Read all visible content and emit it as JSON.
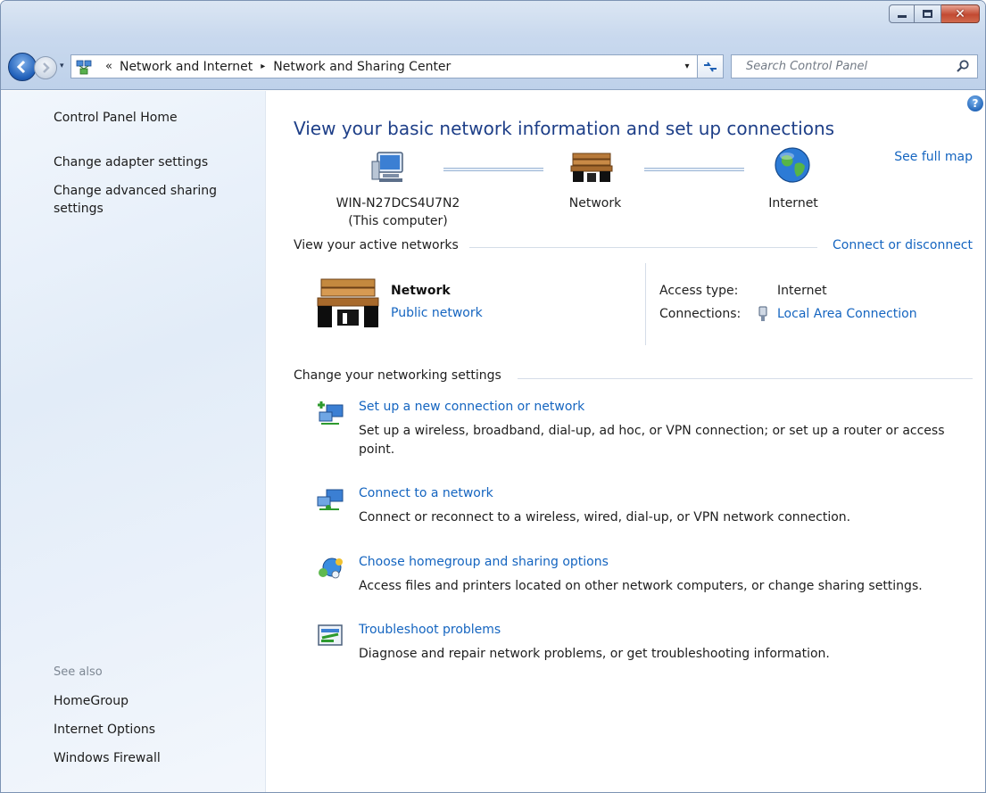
{
  "window": {
    "caption_minimize": "",
    "caption_maximize": "",
    "caption_close": "✕"
  },
  "address_bar": {
    "overflow_chevron": "«",
    "breadcrumbs": [
      "Network and Internet",
      "Network and Sharing Center"
    ],
    "separator": "▸",
    "dropdown_arrow": "▾",
    "refresh_glyph": "↻"
  },
  "search": {
    "placeholder": "Search Control Panel"
  },
  "left_pane": {
    "home": "Control Panel Home",
    "tasks": [
      "Change adapter settings",
      "Change advanced sharing settings"
    ],
    "see_also_label": "See also",
    "see_also": [
      "HomeGroup",
      "Internet Options",
      "Windows Firewall"
    ]
  },
  "main": {
    "title": "View your basic network information and set up connections",
    "see_full_map": "See full map",
    "map": {
      "computer_name": "WIN-N27DCS4U7N2",
      "computer_sub": "(This computer)",
      "network": "Network",
      "internet": "Internet"
    },
    "active_networks_label": "View your active networks",
    "connect_or_disconnect": "Connect or disconnect",
    "active_network": {
      "name": "Network",
      "type": "Public network",
      "access_type_label": "Access type:",
      "access_type_value": "Internet",
      "connections_label": "Connections:",
      "connections_value": "Local Area Connection"
    },
    "settings_label": "Change your networking settings",
    "tasks": [
      {
        "title": "Set up a new connection or network",
        "desc": "Set up a wireless, broadband, dial-up, ad hoc, or VPN connection; or set up a router or access point.",
        "icon": "new-connection-icon"
      },
      {
        "title": "Connect to a network",
        "desc": "Connect or reconnect to a wireless, wired, dial-up, or VPN network connection.",
        "icon": "connect-network-icon"
      },
      {
        "title": "Choose homegroup and sharing options",
        "desc": "Access files and printers located on other network computers, or change sharing settings.",
        "icon": "homegroup-icon"
      },
      {
        "title": "Troubleshoot problems",
        "desc": "Diagnose and repair network problems, or get troubleshooting information.",
        "icon": "troubleshoot-icon"
      }
    ],
    "help_glyph": "?"
  },
  "colors": {
    "link": "#1565c0",
    "title": "#1e3f88",
    "frame": "#c9d9ee"
  }
}
